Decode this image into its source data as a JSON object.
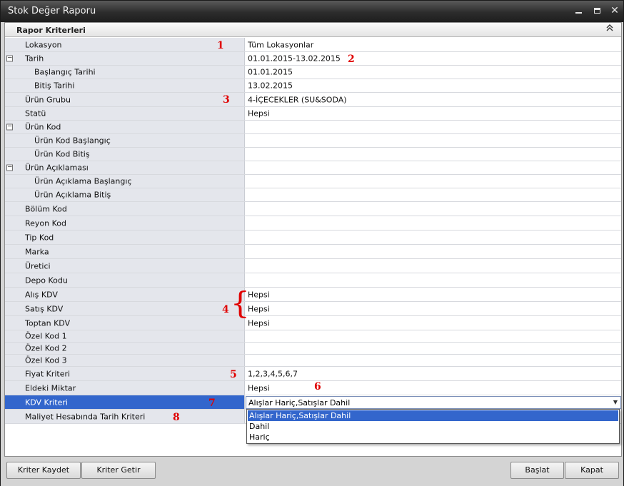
{
  "window": {
    "title": "Stok Değer Raporu",
    "minimize": "minimize",
    "maximize": "maximize",
    "close": "✕"
  },
  "panel": {
    "title": "Rapor Kriterleri",
    "collapse_glyph": "⌃"
  },
  "rows": [
    {
      "label": "Lokasyon",
      "value": "Tüm Lokasyonlar"
    },
    {
      "label": "Tarih",
      "value": "01.01.2015-13.02.2015",
      "expander": "−"
    },
    {
      "label": "Başlangıç Tarihi",
      "value": "01.01.2015"
    },
    {
      "label": "Bitiş Tarihi",
      "value": "13.02.2015"
    },
    {
      "label": "Ürün Grubu",
      "value": "4-İÇECEKLER (SU&SODA)"
    },
    {
      "label": "Statü",
      "value": "Hepsi"
    },
    {
      "label": "Ürün Kod",
      "value": "",
      "expander": "−"
    },
    {
      "label": "Ürün Kod Başlangıç",
      "value": ""
    },
    {
      "label": "Ürün Kod Bitiş",
      "value": ""
    },
    {
      "label": "Ürün Açıklaması",
      "value": "",
      "expander": "−"
    },
    {
      "label": "Ürün Açıklama Başlangıç",
      "value": ""
    },
    {
      "label": "Ürün Açıklama Bitiş",
      "value": ""
    },
    {
      "label": "Bölüm Kod",
      "value": ""
    },
    {
      "label": "Reyon Kod",
      "value": ""
    },
    {
      "label": "Tip Kod",
      "value": ""
    },
    {
      "label": "Marka",
      "value": ""
    },
    {
      "label": "Üretici",
      "value": ""
    },
    {
      "label": "Depo Kodu",
      "value": ""
    },
    {
      "label": "Alış KDV",
      "value": "Hepsi"
    },
    {
      "label": "Satış KDV",
      "value": "Hepsi"
    },
    {
      "label": "Toptan KDV",
      "value": "Hepsi"
    },
    {
      "label": "Özel Kod 1",
      "value": ""
    },
    {
      "label": "Özel Kod 2",
      "value": ""
    },
    {
      "label": "Özel Kod 3",
      "value": ""
    },
    {
      "label": "Fiyat Kriteri",
      "value": "1,2,3,4,5,6,7"
    },
    {
      "label": "Eldeki Miktar",
      "value": "Hepsi"
    },
    {
      "label": "KDV Kriteri",
      "value": "Alışlar Hariç,Satışlar Dahil"
    },
    {
      "label": "Maliyet Hesabında Tarih Kriteri",
      "value": ""
    }
  ],
  "kdv_dropdown": {
    "selected": "Alışlar Hariç,Satışlar Dahil",
    "options": [
      "Alışlar Hariç,Satışlar Dahil",
      "Dahil",
      "Hariç"
    ]
  },
  "annotations": [
    "1",
    "2",
    "3",
    "4",
    "5",
    "6",
    "7",
    "8"
  ],
  "brace": "{",
  "buttons": {
    "save": "Kriter Kaydet",
    "load": "Kriter Getir",
    "start": "Başlat",
    "close": "Kapat"
  }
}
